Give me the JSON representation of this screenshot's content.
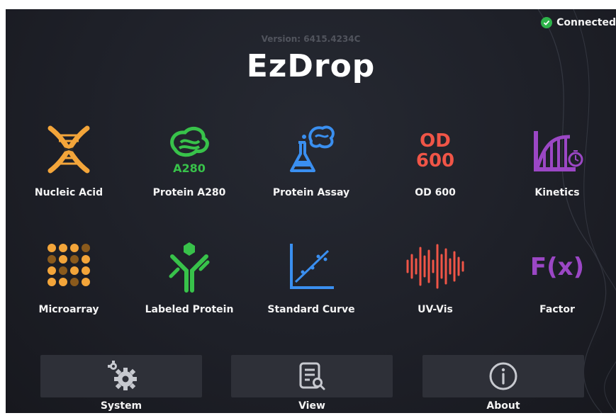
{
  "header": {
    "version": "Version: 6415.4234C",
    "title": "EzDrop",
    "status": "Connected"
  },
  "apps": [
    {
      "label": "Nucleic Acid",
      "icon": "dna-icon",
      "color": "#f3a53a"
    },
    {
      "label": "Protein A280",
      "icon": "protein-a280-icon",
      "color": "#38c24a",
      "icon_text": "A280"
    },
    {
      "label": "Protein Assay",
      "icon": "flask-icon",
      "color": "#3a8ff0"
    },
    {
      "label": "OD 600",
      "icon": "od600-icon",
      "color": "#f05547",
      "icon_text_1": "OD",
      "icon_text_2": "600"
    },
    {
      "label": "Kinetics",
      "icon": "kinetics-icon",
      "color": "#9b47c5"
    },
    {
      "label": "Microarray",
      "icon": "microarray-icon",
      "color": "#f3a53a"
    },
    {
      "label": "Labeled Protein",
      "icon": "antibody-icon",
      "color": "#38c24a"
    },
    {
      "label": "Standard Curve",
      "icon": "standard-curve-icon",
      "color": "#3a8ff0"
    },
    {
      "label": "UV-Vis",
      "icon": "waveform-icon",
      "color": "#f05547"
    },
    {
      "label": "Factor",
      "icon": "factor-icon",
      "color": "#9b47c5",
      "icon_text": "F(x)"
    }
  ],
  "bottom": {
    "system": "System",
    "view": "View",
    "about": "About"
  }
}
